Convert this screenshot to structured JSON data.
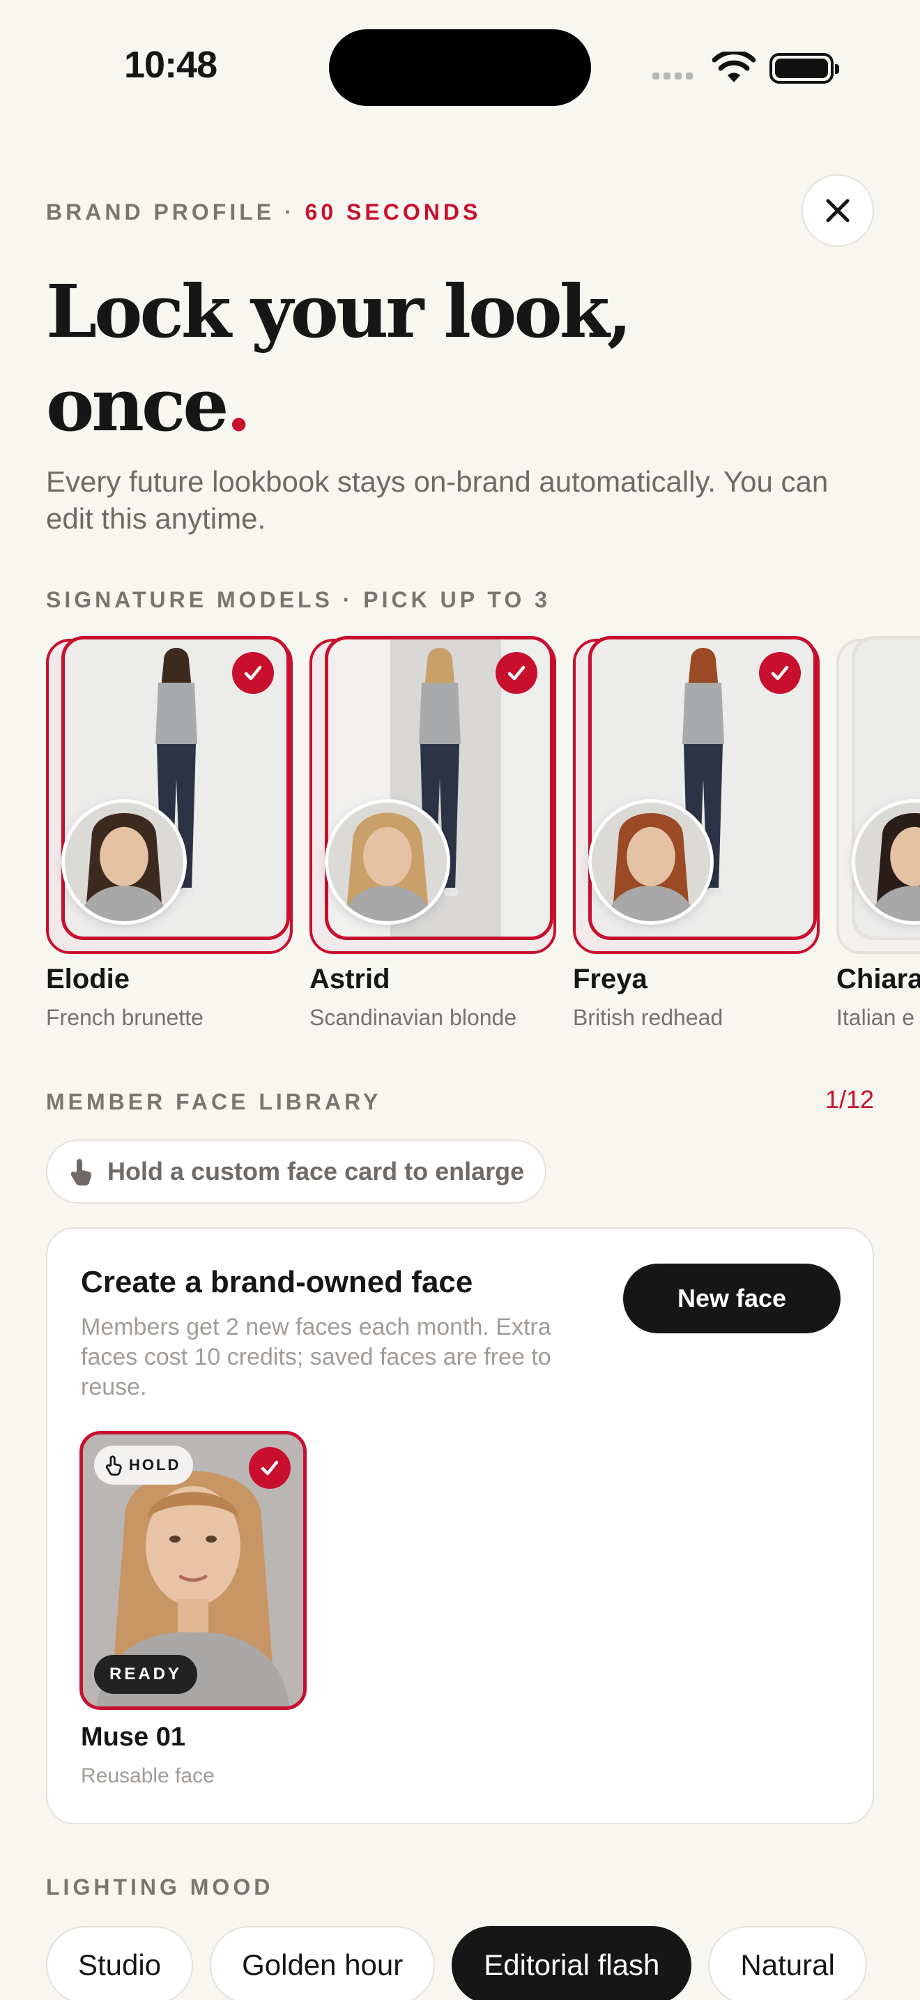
{
  "status_bar": {
    "time": "10:48"
  },
  "header": {
    "eyebrow_prefix": "BRAND PROFILE · ",
    "eyebrow_accent": "60 SECONDS",
    "headline_line1": "Lock your look,",
    "headline_line2": "once",
    "headline_dot": ".",
    "subtitle": "Every future lookbook stays on-brand automatically. You can edit this anytime."
  },
  "signature_models": {
    "section_label": "SIGNATURE MODELS · PICK UP TO 3",
    "models": [
      {
        "name": "Elodie",
        "description": "French brunette",
        "selected": true,
        "hair": "#3d2a1f"
      },
      {
        "name": "Astrid",
        "description": "Scandinavian blonde",
        "selected": true,
        "hair": "#caa06a"
      },
      {
        "name": "Freya",
        "description": "British redhead",
        "selected": true,
        "hair": "#9a4a25"
      },
      {
        "name": "Chiara",
        "description": "Italian e",
        "selected": false,
        "hair": "#2b1d17"
      }
    ]
  },
  "face_library": {
    "section_label": "MEMBER FACE LIBRARY",
    "count": "1/12",
    "hint": "Hold a custom face card to enlarge",
    "panel_title": "Create a brand-owned face",
    "panel_description": "Members get 2 new faces each month. Extra faces cost 10 credits; saved faces are free to reuse.",
    "new_face_label": "New face",
    "faces": [
      {
        "hold_label": "HOLD",
        "status": "READY",
        "name": "Muse 01",
        "subtitle": "Reusable face"
      }
    ]
  },
  "lighting": {
    "section_label": "LIGHTING MOOD",
    "options": [
      "Studio",
      "Golden hour",
      "Editorial flash",
      "Natural"
    ],
    "selected": "Editorial flash"
  },
  "colors": {
    "accent": "#c8102e",
    "background": "#f8f6f1",
    "ink": "#161616"
  }
}
